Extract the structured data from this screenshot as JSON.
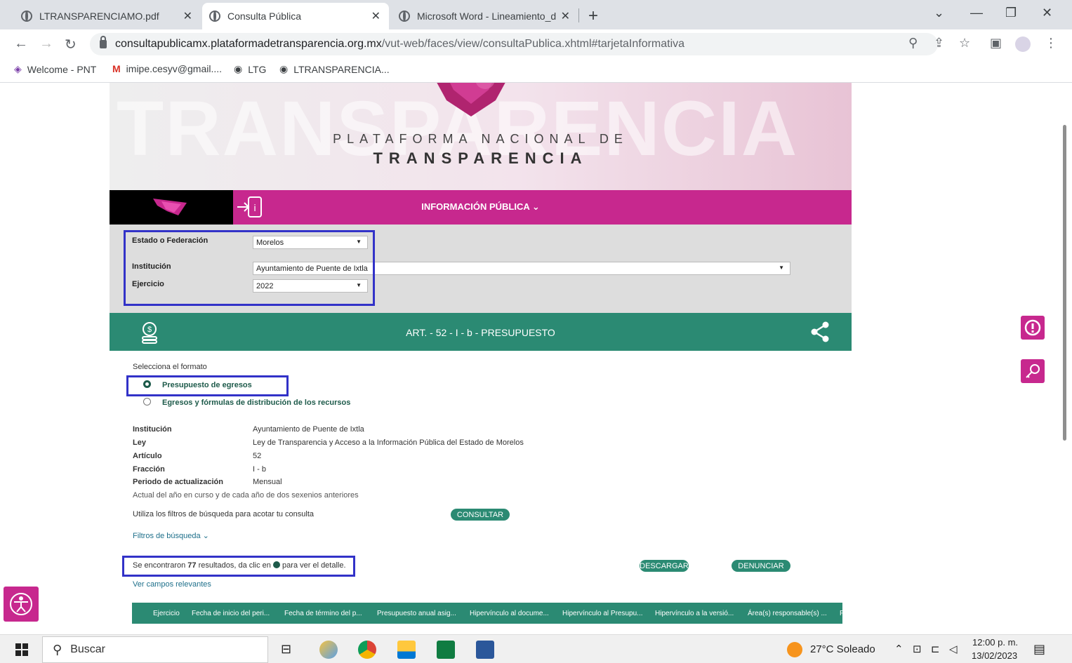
{
  "browser": {
    "tabs": [
      {
        "title": "LTRANSPARENCIAMO.pdf"
      },
      {
        "title": "Consulta Pública"
      },
      {
        "title": "Microsoft Word - Lineamiento_d"
      }
    ],
    "url_host": "consultapublicamx.plataformadetransparencia.org.mx",
    "url_path": "/vut-web/faces/view/consultaPublica.xhtml#tarjetaInformativa",
    "bookmarks": [
      {
        "label": "Welcome - PNT"
      },
      {
        "label": "imipe.cesyv@gmail...."
      },
      {
        "label": "LTG"
      },
      {
        "label": "LTRANSPARENCIA..."
      }
    ]
  },
  "banner": {
    "watermark": "TRANSPARENCIA",
    "line1": "PLATAFORMA NACIONAL DE",
    "line2": "TRANSPARENCIA"
  },
  "infobar": {
    "title": "INFORMACIÓN PÚBLICA ⌄"
  },
  "filters": {
    "estado_label": "Estado o Federación",
    "estado_value": "Morelos",
    "institucion_label": "Institución",
    "institucion_value": "Ayuntamiento de Puente de Ixtla",
    "ejercicio_label": "Ejercicio",
    "ejercicio_value": "2022"
  },
  "article": {
    "title": "ART. - 52 - I - b - PRESUPUESTO"
  },
  "format": {
    "label": "Selecciona el formato",
    "option1": "Presupuesto de egresos",
    "option2": "Egresos y fórmulas de distribución de los recursos"
  },
  "details": [
    {
      "label": "Institución",
      "value": "Ayuntamiento de Puente de Ixtla"
    },
    {
      "label": "Ley",
      "value": "Ley de Transparencia y Acceso a la Información Pública del Estado de Morelos"
    },
    {
      "label": "Artículo",
      "value": "52"
    },
    {
      "label": "Fracción",
      "value": "I - b"
    },
    {
      "label": "Periodo de actualización",
      "value": "Mensual"
    }
  ],
  "period_note": "Actual del año en curso y de cada año de dos sexenios anteriores",
  "filter_hint": "Utiliza los filtros de búsqueda para acotar tu consulta",
  "consultar": "CONSULTAR",
  "filtros_busqueda": "Filtros de búsqueda ⌄",
  "results": {
    "prefix": "Se encontraron ",
    "count": "77",
    "middle": " resultados, da clic en ",
    "suffix": " para ver el detalle."
  },
  "descargar": "DESCARGAR",
  "denunciar": "DENUNCIAR",
  "ver_campos": "Ver campos relevantes",
  "columns": [
    "Ejercicio",
    "Fecha de inicio del peri...",
    "Fecha de término del p...",
    "Presupuesto anual asig...",
    "Hipervínculo al docume...",
    "Hipervínculo al Presupu...",
    "Hipervínculo a la versió...",
    "Área(s) responsable(s) ...",
    "F"
  ],
  "taskbar": {
    "search_placeholder": "Buscar",
    "weather": "27°C  Soleado",
    "time": "12:00 p. m.",
    "date": "13/02/2023"
  }
}
